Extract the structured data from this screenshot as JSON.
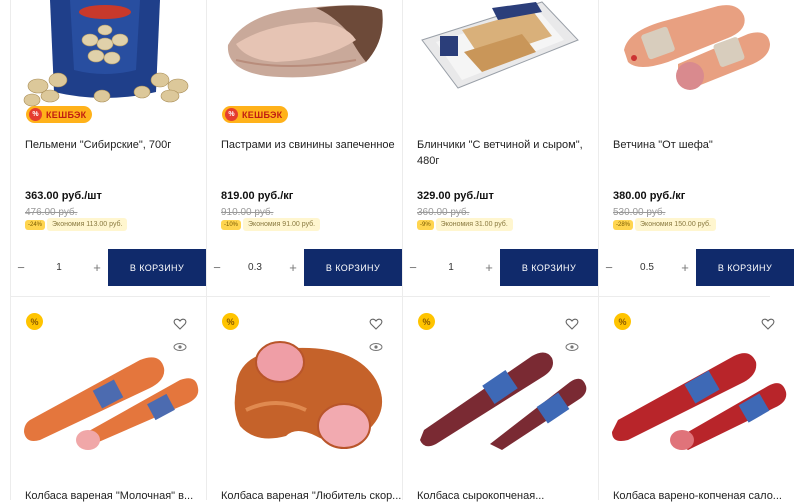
{
  "products": [
    {
      "title": "Пельмени \"Сибирские\", 700г",
      "price": "363.00 руб./шт",
      "old_price": "476.00 руб.",
      "badge": "-24%",
      "econ": "Экономия 113.00 руб.",
      "qty": "1",
      "cart": "В КОРЗИНУ",
      "cashback": "КЕШБЭК"
    },
    {
      "title": "Пастрами из свинины запеченное",
      "price": "819.00 руб./кг",
      "old_price": "910.00 руб.",
      "badge": "-10%",
      "econ": "Экономия 91.00 руб.",
      "qty": "0.3",
      "cart": "В КОРЗИНУ",
      "cashback": "КЕШБЭК"
    },
    {
      "title": "Блинчики \"С ветчиной и сыром\", 480г",
      "price": "329.00 руб./шт",
      "old_price": "360.00 руб.",
      "badge": "-9%",
      "econ": "Экономия 31.00 руб.",
      "qty": "1",
      "cart": "В КОРЗИНУ"
    },
    {
      "title": "Ветчина \"От шефа\"",
      "price": "380.00 руб./кг",
      "old_price": "530.00 руб.",
      "badge": "-28%",
      "econ": "Экономия 150.00 руб.",
      "qty": "0.5",
      "cart": "В КОРЗИНУ"
    }
  ],
  "bottom_titles": [
    "Колбаса вареная \"Молочная\" в...",
    "Колбаса вареная \"Любитель скор...",
    "Колбаса сырокопченая...",
    "Колбаса варено-копченая сало..."
  ],
  "promo_icon": "%",
  "colors": {
    "cart": "#102a6b",
    "cashback": "#ffb21a",
    "promo": "#ffc400"
  }
}
